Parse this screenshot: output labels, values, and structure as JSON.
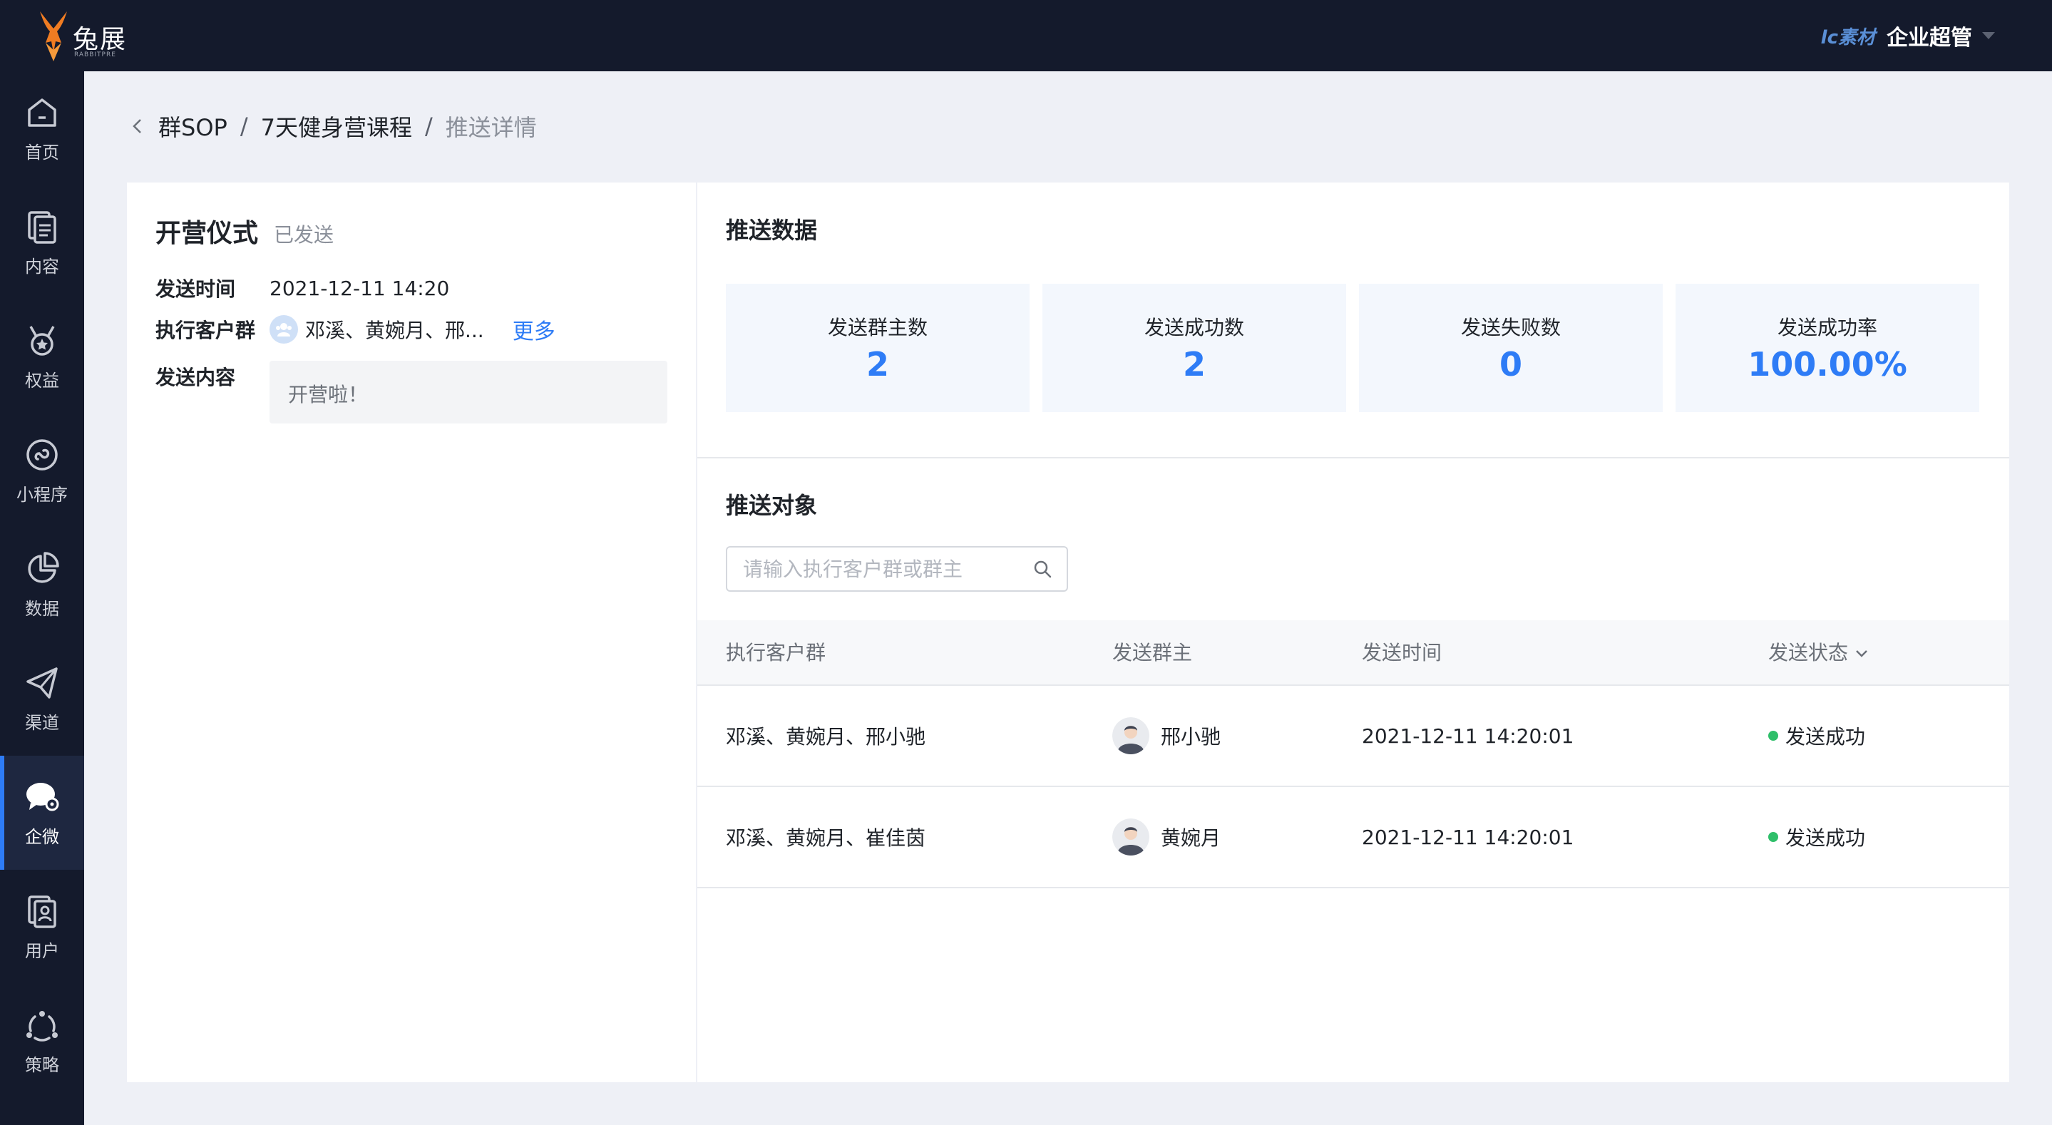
{
  "app": {
    "logo_text": "兔展",
    "logo_sub": "RABBITPRE",
    "brand_tag": "lc素材",
    "admin_name": "企业超管"
  },
  "sidebar": {
    "items": [
      {
        "label": "首页",
        "icon": "home-icon"
      },
      {
        "label": "内容",
        "icon": "document-icon"
      },
      {
        "label": "权益",
        "icon": "medal-icon"
      },
      {
        "label": "小程序",
        "icon": "mini-program-icon"
      },
      {
        "label": "数据",
        "icon": "pie-chart-icon"
      },
      {
        "label": "渠道",
        "icon": "send-icon"
      },
      {
        "label": "企微",
        "icon": "chat-icon"
      },
      {
        "label": "用户",
        "icon": "user-card-icon"
      },
      {
        "label": "策略",
        "icon": "strategy-icon"
      }
    ],
    "active": "企微"
  },
  "breadcrumb": {
    "items": [
      "群SOP",
      "7天健身营课程"
    ],
    "current": "推送详情",
    "separator": "/"
  },
  "detail": {
    "title": "开营仪式",
    "status": "已发送",
    "send_time_label": "发送时间",
    "send_time": "2021-12-11 14:20",
    "groups_label": "执行客户群",
    "groups_value": "邓溪、黄婉月、邢...",
    "more_label": "更多",
    "content_label": "发送内容",
    "content": "开营啦！"
  },
  "push_data": {
    "title": "推送数据",
    "stats": [
      {
        "label": "发送群主数",
        "value": "2"
      },
      {
        "label": "发送成功数",
        "value": "2"
      },
      {
        "label": "发送失败数",
        "value": "0"
      },
      {
        "label": "发送成功率",
        "value": "100.00%"
      }
    ]
  },
  "push_targets": {
    "title": "推送对象",
    "search_placeholder": "请输入执行客户群或群主",
    "columns": [
      "执行客户群",
      "发送群主",
      "发送时间",
      "发送状态"
    ],
    "rows": [
      {
        "groups": "邓溪、黄婉月、邢小驰",
        "owner": "邢小驰",
        "time": "2021-12-11 14:20:01",
        "status": "发送成功"
      },
      {
        "groups": "邓溪、黄婉月、崔佳茵",
        "owner": "黄婉月",
        "time": "2021-12-11 14:20:01",
        "status": "发送成功"
      }
    ]
  },
  "colors": {
    "accent": "#2e7cf6",
    "success": "#2fbf6a",
    "nav_bg": "#141a2c"
  }
}
